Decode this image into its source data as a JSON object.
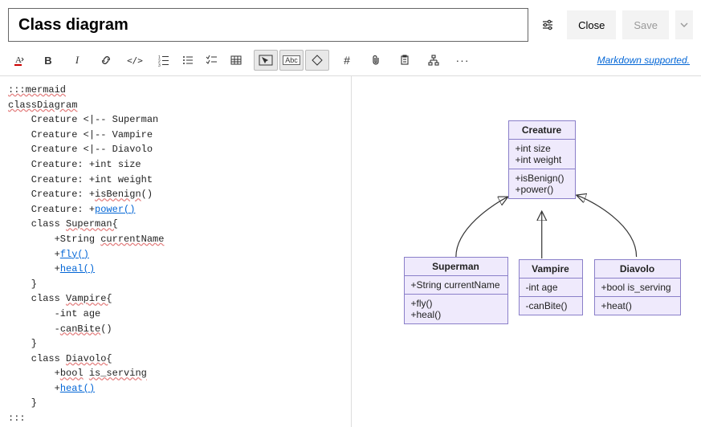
{
  "header": {
    "title": "Class diagram",
    "close": "Close",
    "save": "Save"
  },
  "toolbar": {
    "markdown": "Markdown supported."
  },
  "editor": {
    "l0": ":::mermaid",
    "l1": "classDiagram",
    "l2": "    Creature <|-- Superman",
    "l3": "    Creature <|-- Vampire",
    "l4": "    Creature <|-- Diavolo",
    "l5": "    Creature: +int size",
    "l6": "    Creature: +int weight",
    "l7a": "    Creature: +",
    "l7b": "isBenign",
    "l7c": "()",
    "l8a": "    Creature: +",
    "l8b": "power()",
    "l9a": "    class ",
    "l9b": "Superman{",
    "l10a": "        +String ",
    "l10b": "currentName",
    "l11a": "        +",
    "l11b": "fly()",
    "l12a": "        +",
    "l12b": "heal()",
    "l13": "    }",
    "l14a": "    class ",
    "l14b": "Vampire{",
    "l15": "        -int age",
    "l16a": "        -",
    "l16b": "canBite",
    "l16c": "()",
    "l17": "    }",
    "l18a": "    class ",
    "l18b": "Diavolo{",
    "l19a": "        +",
    "l19b": "bool",
    "l19c": " ",
    "l19d": "is_serving",
    "l20a": "        +",
    "l20b": "heat()",
    "l21": "    }",
    "l22": ":::"
  },
  "diagram": {
    "creature": {
      "name": "Creature",
      "a1": "+int size",
      "a2": "+int weight",
      "m1": "+isBenign()",
      "m2": "+power()"
    },
    "superman": {
      "name": "Superman",
      "a1": "+String currentName",
      "m1": "+fly()",
      "m2": "+heal()"
    },
    "vampire": {
      "name": "Vampire",
      "a1": "-int age",
      "m1": "-canBite()"
    },
    "diavolo": {
      "name": "Diavolo",
      "a1": "+bool is_serving",
      "m1": "+heat()"
    }
  }
}
